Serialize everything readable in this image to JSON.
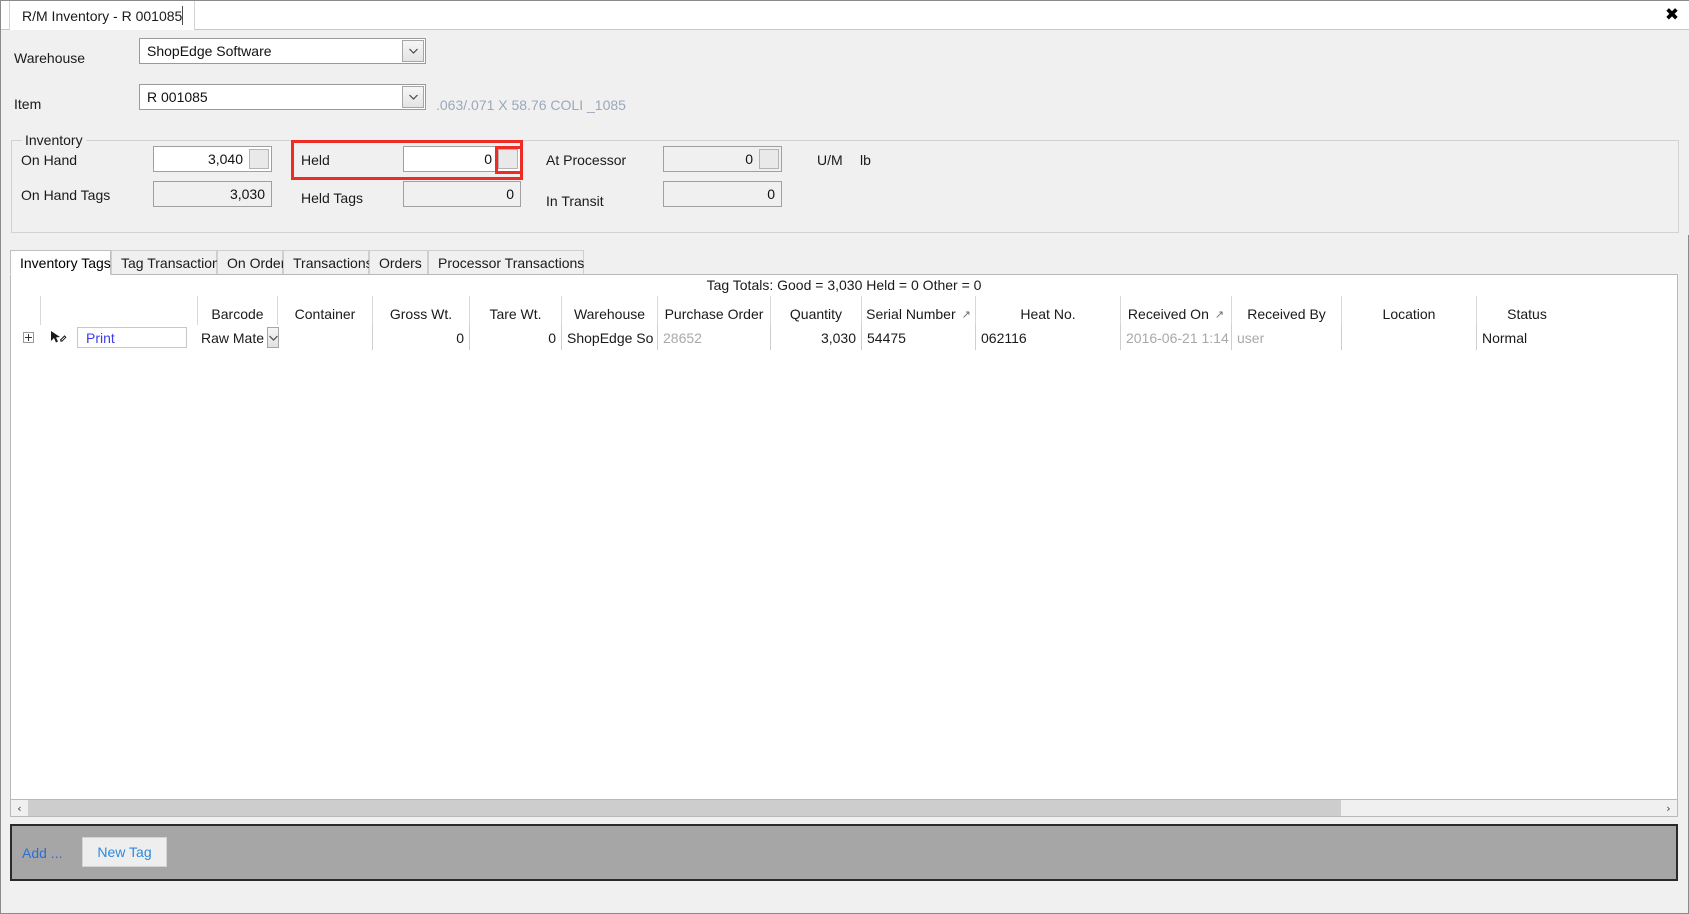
{
  "window": {
    "tab_title": "R/M Inventory - R 001085",
    "close_label": "✖"
  },
  "form": {
    "warehouse_label": "Warehouse",
    "warehouse_value": "ShopEdge Software",
    "item_label": "Item",
    "item_value": "R 001085",
    "item_description": ".063/.071 X 58.76 COLI  _1085"
  },
  "inventory": {
    "group_title": "Inventory",
    "on_hand_label": "On Hand",
    "on_hand_value": "3,040",
    "on_hand_tags_label": "On Hand Tags",
    "on_hand_tags_value": "3,030",
    "held_label": "Held",
    "held_value": "0",
    "held_tags_label": "Held Tags",
    "held_tags_value": "0",
    "at_processor_label": "At Processor",
    "at_processor_value": "0",
    "in_transit_label": "In Transit",
    "in_transit_value": "0",
    "um_label": "U/M",
    "um_value": "lb"
  },
  "tabs": [
    {
      "label": "Inventory Tags",
      "active": true
    },
    {
      "label": "Tag Transactions",
      "active": false
    },
    {
      "label": "On Order",
      "active": false
    },
    {
      "label": "Transactions",
      "active": false
    },
    {
      "label": "Orders",
      "active": false
    },
    {
      "label": "Processor Transactions",
      "active": false
    }
  ],
  "grid": {
    "tag_totals": "Tag Totals:  Good = 3,030 Held = 0 Other = 0",
    "columns": [
      {
        "label": "Barcode",
        "sort": ""
      },
      {
        "label": "Container",
        "sort": ""
      },
      {
        "label": "Gross Wt.",
        "sort": ""
      },
      {
        "label": "Tare Wt.",
        "sort": ""
      },
      {
        "label": "Warehouse",
        "sort": ""
      },
      {
        "label": "Purchase Order",
        "sort": ""
      },
      {
        "label": "Quantity",
        "sort": ""
      },
      {
        "label": "Serial Number",
        "sort": "↗"
      },
      {
        "label": "Heat No.",
        "sort": ""
      },
      {
        "label": "Received On",
        "sort": "↗"
      },
      {
        "label": "Received By",
        "sort": ""
      },
      {
        "label": "Location",
        "sort": ""
      },
      {
        "label": "Status",
        "sort": ""
      }
    ],
    "row": {
      "print_link": "Print",
      "barcode": "Raw Mate",
      "container": "",
      "gross_wt": "0",
      "tare_wt": "0",
      "warehouse": "ShopEdge So",
      "purchase_order": "28652",
      "quantity": "3,030",
      "serial_number": "54475",
      "heat_no": "062116",
      "received_on": "2016-06-21 1:14",
      "received_by": "user",
      "location": "",
      "status": "Normal"
    }
  },
  "scrollbar": {
    "left_arrow": "‹",
    "right_arrow": "›"
  },
  "bottombar": {
    "add_label": "Add ...",
    "new_tag_label": "New Tag"
  },
  "colors": {
    "highlight": "#ee2b24",
    "link": "#3d3df0",
    "accent": "#2b8ae0"
  }
}
